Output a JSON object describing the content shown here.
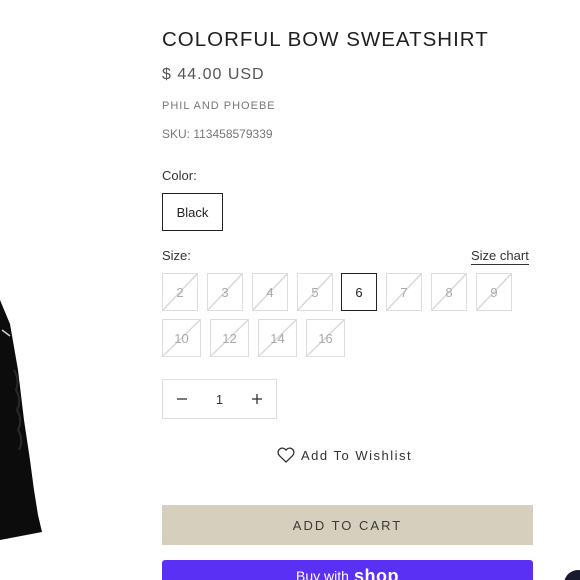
{
  "product": {
    "title": "COLORFUL BOW SWEATSHIRT",
    "price": "$ 44.00 USD",
    "vendor": "PHIL AND PHOEBE",
    "sku": "SKU: 113458579339"
  },
  "color": {
    "label": "Color:",
    "options": [
      "Black"
    ],
    "selected": "Black"
  },
  "size": {
    "label": "Size:",
    "chart_link": "Size chart",
    "options": [
      {
        "label": "2",
        "available": false
      },
      {
        "label": "3",
        "available": false
      },
      {
        "label": "4",
        "available": false
      },
      {
        "label": "5",
        "available": false
      },
      {
        "label": "6",
        "available": true
      },
      {
        "label": "7",
        "available": false
      },
      {
        "label": "8",
        "available": false
      },
      {
        "label": "9",
        "available": false
      },
      {
        "label": "10",
        "available": false
      },
      {
        "label": "12",
        "available": false
      },
      {
        "label": "14",
        "available": false
      },
      {
        "label": "16",
        "available": false
      }
    ],
    "selected": "6"
  },
  "quantity": {
    "value": "1",
    "minus_icon": "minus-icon",
    "plus_icon": "plus-icon"
  },
  "wishlist": {
    "label": "Add To Wishlist",
    "icon": "heart-icon"
  },
  "cart": {
    "add_label": "ADD TO CART",
    "button_color": "#d7cfbd"
  },
  "shop_pay": {
    "label": "Buy with",
    "logo_text": "shop",
    "button_color": "#5a31f4"
  },
  "chat": {
    "icon": "chat-icon"
  }
}
